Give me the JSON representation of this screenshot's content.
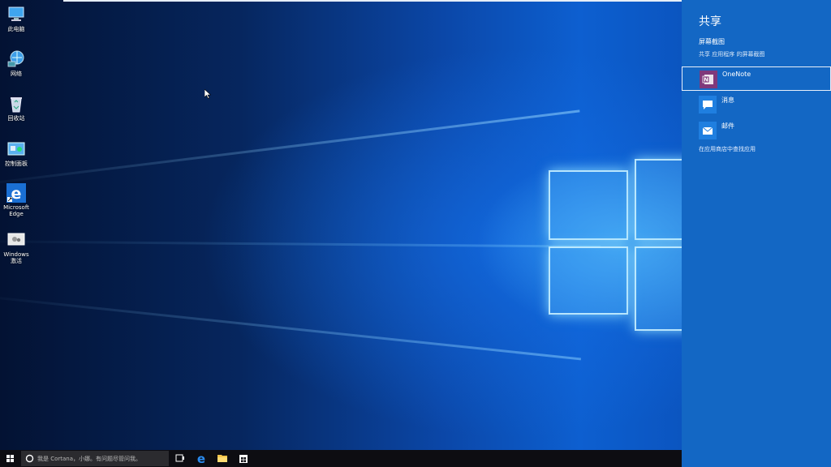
{
  "desktop": {
    "icons": [
      {
        "label": "此电脑",
        "icon": "computer-icon"
      },
      {
        "label": "网络",
        "icon": "network-icon"
      },
      {
        "label": "回收站",
        "icon": "recycle-bin-icon"
      },
      {
        "label": "控制面板",
        "icon": "control-panel-icon"
      },
      {
        "label": "Microsoft Edge",
        "icon": "edge-icon"
      },
      {
        "label": "Windows激活",
        "icon": "windows-activation-icon"
      }
    ]
  },
  "share": {
    "title": "共享",
    "subtitle": "屏幕截图",
    "description": "共享 应用程序 的屏幕截图",
    "items": [
      {
        "label": "OneNote",
        "icon": "onenote-icon",
        "color": "#80397b"
      },
      {
        "label": "消息",
        "icon": "message-icon",
        "color": "#1f7fe0"
      },
      {
        "label": "邮件",
        "icon": "mail-icon",
        "color": "#1f7fe0"
      }
    ],
    "store_link": "在应用商店中查找应用"
  },
  "taskbar": {
    "search_placeholder": "我是 Cortana，小娜。有问题尽管问我。",
    "buttons": [
      "task-view-icon",
      "edge-icon",
      "file-explorer-icon",
      "store-icon"
    ]
  },
  "colors": {
    "panel": "#1367c4",
    "taskbar": "#0d0d12",
    "accent": "#0b5fd0"
  }
}
